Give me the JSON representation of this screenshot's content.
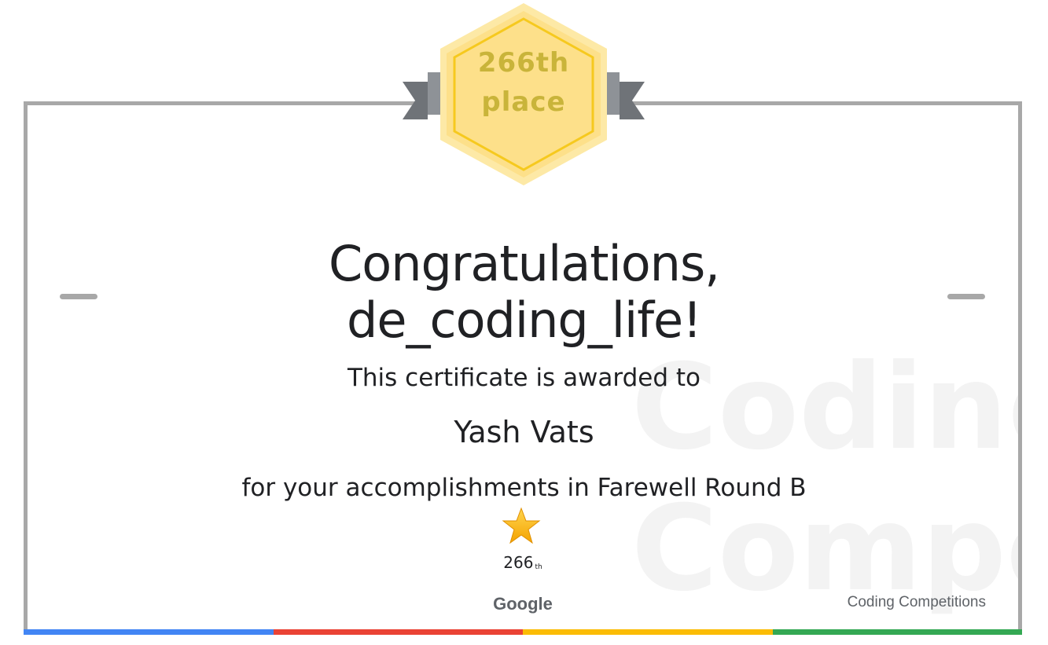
{
  "badge": {
    "line1": "266th",
    "line2": "place"
  },
  "certificate": {
    "congrats_line1": "Congratulations,",
    "congrats_line2": "de_coding_life!",
    "awarded_text": "This certificate is awarded to",
    "recipient": "Yash Vats",
    "accomplishment": "for your accomplishments in Farewell Round B",
    "rank_number": "266",
    "rank_suffix": "th",
    "star_icon": "star-icon"
  },
  "footer": {
    "logo": "Google",
    "program": "Coding Competitions"
  },
  "watermark": {
    "line1": "Coding",
    "line2": "Competitions"
  },
  "colors": {
    "frame": "#a8a8a8",
    "badge_fill": "#fde08a",
    "badge_border": "#f6c91e",
    "ribbon": "#8e9297",
    "blue": "#4285f4",
    "red": "#ea4335",
    "yellow": "#fbbc04",
    "green": "#34a853"
  }
}
